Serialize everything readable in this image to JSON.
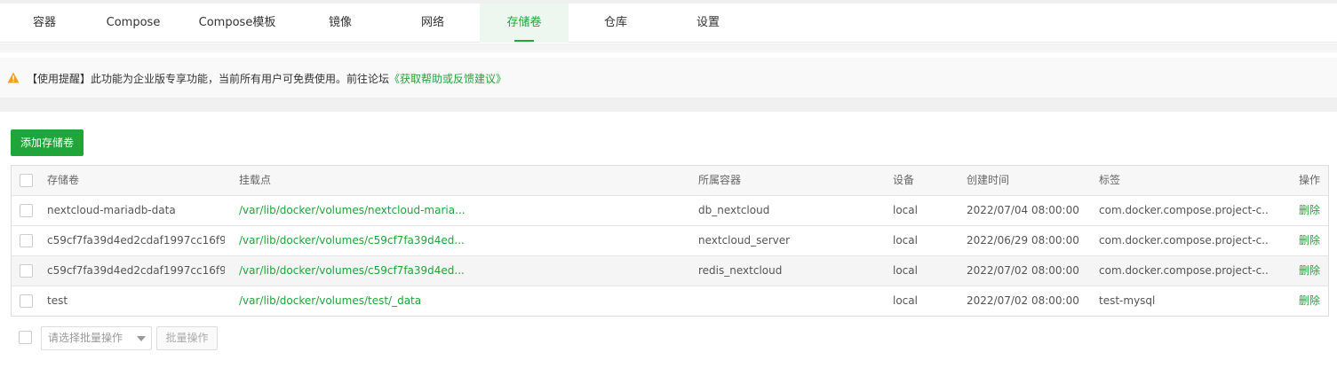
{
  "tabs": [
    {
      "label": "容器"
    },
    {
      "label": "Compose"
    },
    {
      "label": "Compose模板"
    },
    {
      "label": "镜像"
    },
    {
      "label": "网络"
    },
    {
      "label": "存储卷"
    },
    {
      "label": "仓库"
    },
    {
      "label": "设置"
    }
  ],
  "active_tab": "存储卷",
  "notice": {
    "icon": "warning-icon",
    "text": "【使用提醒】此功能为企业版专享功能，当前所有用户可免费使用。前往论坛",
    "link": "《获取帮助或反馈建议》"
  },
  "add_button": "添加存储卷",
  "table": {
    "headers": {
      "name": "存储卷",
      "mountpoint": "挂载点",
      "container": "所属容器",
      "driver": "设备",
      "created": "创建时间",
      "labels": "标签",
      "actions": "操作"
    },
    "rows": [
      {
        "name": "nextcloud-mariadb-data",
        "mountpoint": "/var/lib/docker/volumes/nextcloud-maria...",
        "container": "db_nextcloud",
        "driver": "local",
        "created": "2022/07/04 08:00:00",
        "labels": "com.docker.compose.project-c...",
        "action": "删除"
      },
      {
        "name": "c59cf7fa39d4ed2cdaf1997cc16f9...",
        "mountpoint": "/var/lib/docker/volumes/c59cf7fa39d4ed...",
        "container": "nextcloud_server",
        "driver": "local",
        "created": "2022/06/29 08:00:00",
        "labels": "com.docker.compose.project-c...",
        "action": "删除"
      },
      {
        "name": "c59cf7fa39d4ed2cdaf1997cc16f9...",
        "mountpoint": "/var/lib/docker/volumes/c59cf7fa39d4ed...",
        "container": "redis_nextcloud",
        "driver": "local",
        "created": "2022/07/02 08:00:00",
        "labels": "com.docker.compose.project-c...",
        "action": "删除"
      },
      {
        "name": "test",
        "mountpoint": "/var/lib/docker/volumes/test/_data",
        "container": "",
        "driver": "local",
        "created": "2022/07/02 08:00:00",
        "labels": "test-mysql",
        "action": "删除"
      }
    ]
  },
  "batch": {
    "select_placeholder": "请选择批量操作",
    "button": "批量操作"
  },
  "colors": {
    "accent": "#20a53a",
    "warning": "#f0a020"
  }
}
